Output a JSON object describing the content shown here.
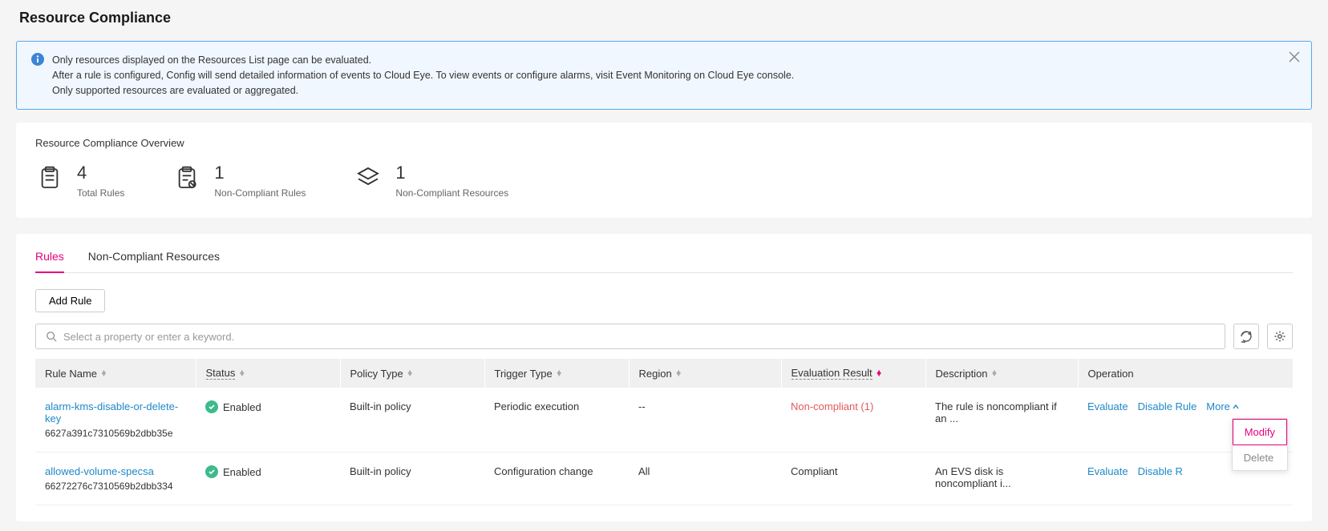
{
  "page_title": "Resource Compliance",
  "notice": {
    "line1": "Only resources displayed on the Resources List page can be evaluated.",
    "line2": "After a rule is configured, Config will send detailed information of events to Cloud Eye. To view events or configure alarms, visit Event Monitoring on Cloud Eye console.",
    "line3": "Only supported resources are evaluated or aggregated."
  },
  "overview": {
    "title": "Resource Compliance Overview",
    "stats": [
      {
        "value": "4",
        "label": "Total Rules"
      },
      {
        "value": "1",
        "label": "Non-Compliant Rules"
      },
      {
        "value": "1",
        "label": "Non-Compliant Resources"
      }
    ]
  },
  "tabs": [
    {
      "label": "Rules",
      "active": true
    },
    {
      "label": "Non-Compliant Resources",
      "active": false
    }
  ],
  "add_rule_label": "Add Rule",
  "search_placeholder": "Select a property or enter a keyword.",
  "columns": {
    "rule_name": "Rule Name",
    "status": "Status",
    "policy_type": "Policy Type",
    "trigger_type": "Trigger Type",
    "region": "Region",
    "evaluation_result": "Evaluation Result",
    "description": "Description",
    "operation": "Operation"
  },
  "rows": [
    {
      "name": "alarm-kms-disable-or-delete-key",
      "id": "6627a391c7310569b2dbb35e",
      "status": "Enabled",
      "policy_type": "Built-in policy",
      "trigger_type": "Periodic execution",
      "region": "--",
      "evaluation_result": "Non-compliant (1)",
      "evaluation_class": "noncomp",
      "description": "The rule is noncompliant if an ...",
      "ops": {
        "evaluate": "Evaluate",
        "disable": "Disable Rule",
        "more": "More"
      },
      "dropdown_open": true
    },
    {
      "name": "allowed-volume-specsa",
      "id": "66272276c7310569b2dbb334",
      "status": "Enabled",
      "policy_type": "Built-in policy",
      "trigger_type": "Configuration change",
      "region": "All",
      "evaluation_result": "Compliant",
      "evaluation_class": "",
      "description": "An EVS disk is noncompliant i...",
      "ops": {
        "evaluate": "Evaluate",
        "disable": "Disable R",
        "more": ""
      },
      "dropdown_open": false
    }
  ],
  "dropdown": {
    "modify": "Modify",
    "delete": "Delete"
  }
}
